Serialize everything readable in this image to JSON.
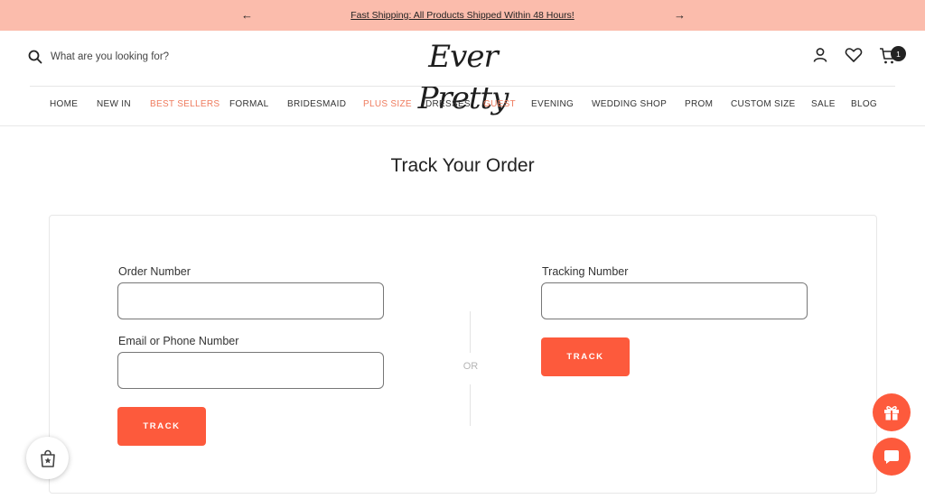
{
  "announcement": {
    "text": "Fast Shipping: All Products Shipped Within 48 Hours!"
  },
  "header": {
    "search_placeholder": "What are you looking for?",
    "logo": "Ever Pretty",
    "cart_count": "1"
  },
  "nav": {
    "items": [
      {
        "label": "HOME",
        "highlight": false
      },
      {
        "label": "NEW IN",
        "highlight": false
      },
      {
        "label": "BEST SELLERS",
        "highlight": true
      },
      {
        "label": "FORMAL",
        "highlight": false
      },
      {
        "label": "BRIDESMAID",
        "highlight": false
      },
      {
        "label": "PLUS SIZE",
        "highlight": true
      },
      {
        "label": "DRESSES",
        "highlight": false
      },
      {
        "label": "GUEST",
        "highlight": true
      },
      {
        "label": "EVENING",
        "highlight": false
      },
      {
        "label": "WEDDING SHOP",
        "highlight": false
      },
      {
        "label": "PROM",
        "highlight": false
      },
      {
        "label": "CUSTOM SIZE",
        "highlight": false
      },
      {
        "label": "SALE",
        "highlight": false
      },
      {
        "label": "BLOG",
        "highlight": false
      }
    ]
  },
  "page": {
    "title": "Track Your Order"
  },
  "form": {
    "order_number_label": "Order Number",
    "order_number_value": "",
    "email_phone_label": "Email or Phone Number",
    "email_phone_value": "",
    "track_button": "TRACK",
    "or_label": "OR",
    "tracking_number_label": "Tracking Number",
    "tracking_number_value": "",
    "track_button_2": "TRACK"
  },
  "colors": {
    "announcement_bg": "#fbbcac",
    "accent": "#fd5a3c",
    "nav_highlight": "#ef7b5d"
  },
  "icons": [
    "arrow-left-icon",
    "arrow-right-icon",
    "search-icon",
    "user-icon",
    "heart-icon",
    "cart-icon",
    "gift-icon",
    "chat-icon",
    "shopping-bag-star-icon"
  ]
}
